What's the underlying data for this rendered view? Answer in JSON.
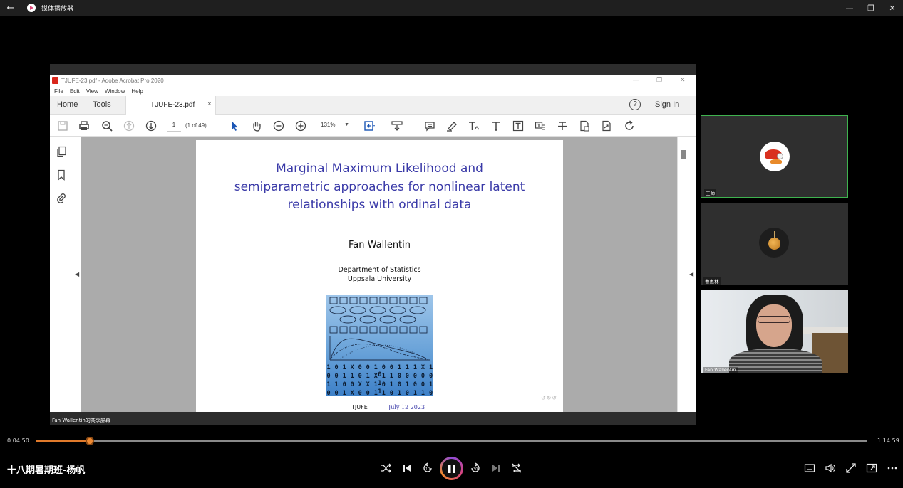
{
  "player": {
    "app_title": "媒体播放器",
    "current_time": "0:04:50",
    "total_time": "1:14:59",
    "progress_fraction": 0.0645,
    "media_title": "十八期暑期班-杨帆",
    "accent_color": "#e07a2b"
  },
  "acrobat": {
    "window_title": "TJUFE-23.pdf - Adobe Acrobat Pro 2020",
    "menu": [
      "File",
      "Edit",
      "View",
      "Window",
      "Help"
    ],
    "tab_home": "Home",
    "tab_tools": "Tools",
    "doc_tab": "TJUFE-23.pdf",
    "doc_tab_close": "×",
    "help": "?",
    "sign_in": "Sign In",
    "page_number": "1",
    "page_count": "(1 of 49)",
    "zoom": "131%"
  },
  "slide": {
    "title_lines": [
      "Marginal Maximum Likelihood and",
      "semiparametric approaches for nonlinear latent",
      "relationships with ordinal data"
    ],
    "author": "Fan Wallentin",
    "department": "Department of Statistics",
    "university": "Uppsala University",
    "binary_rows": [
      "1 0 1 X 0 0 1 0 0 1 1 1 X 1 0",
      "0 0 1 1 0 1 X 1 1 0 0 0 0 0 1",
      "1 1 0 0 X X 1 0 1 0 1 0 0 1 1",
      "0 0 1 X 0 0 1 1 0 1 0 1 1 0 1"
    ],
    "footer_org": "TJUFE",
    "footer_date": "July 12 2023"
  },
  "share_label": "Fan Wallentin的共享屏幕",
  "participants": [
    {
      "name": "王帅"
    },
    {
      "name": "曹惠林"
    },
    {
      "name": "Fan Wallentin"
    }
  ]
}
